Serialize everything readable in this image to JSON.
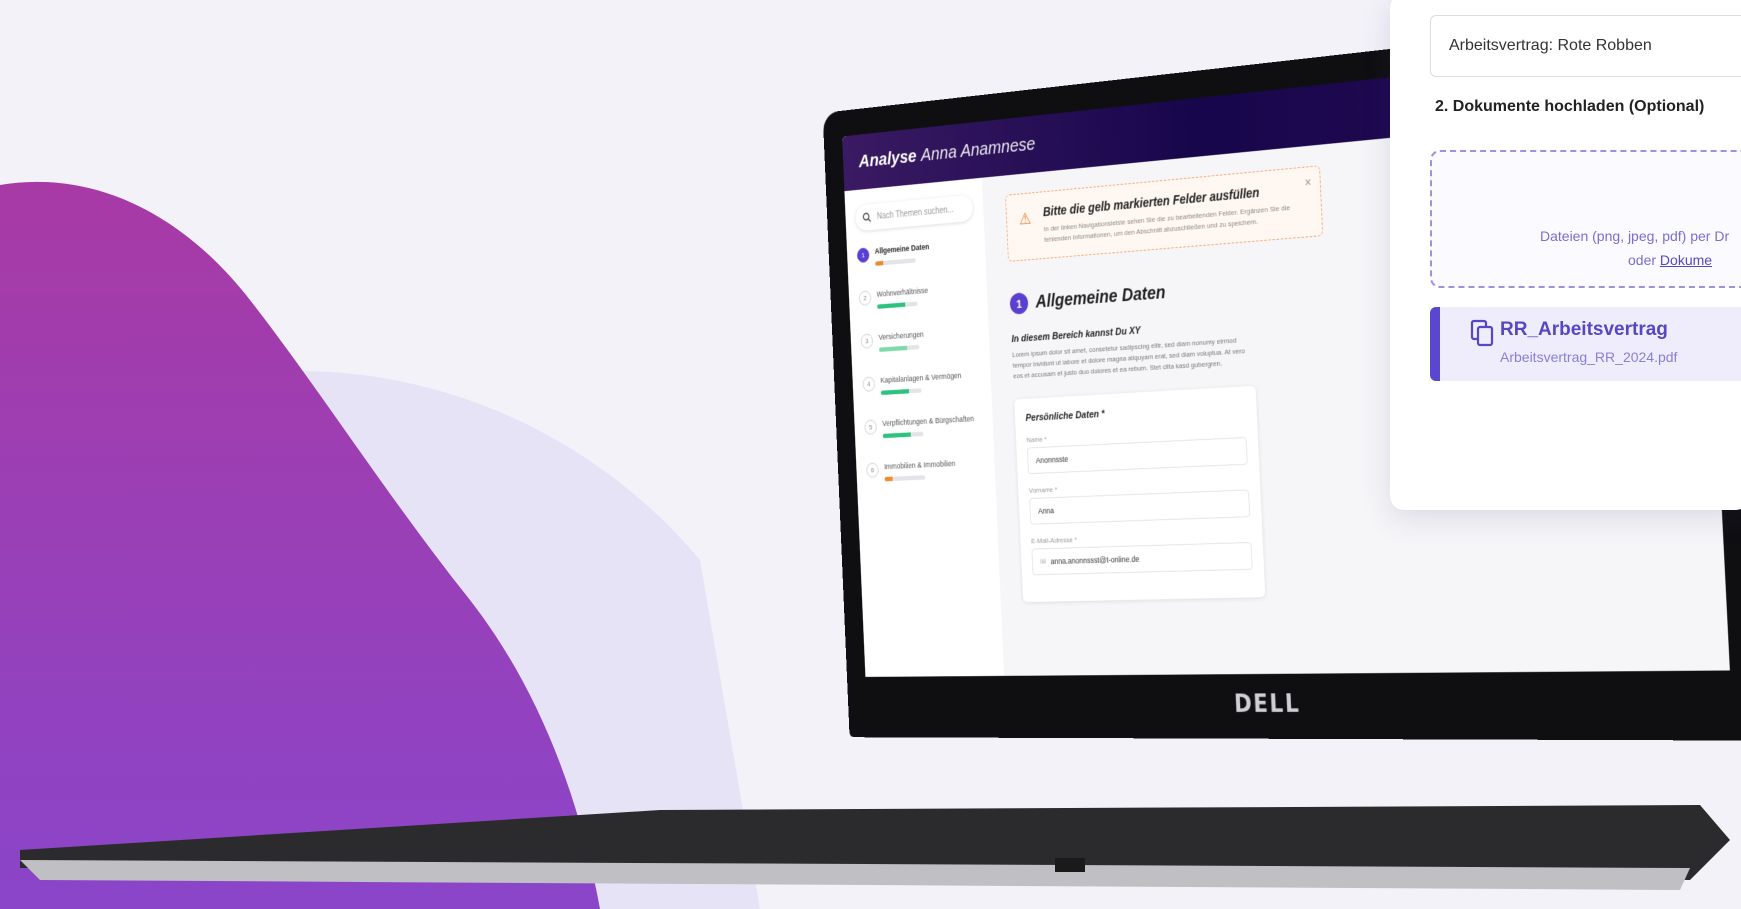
{
  "app": {
    "title_bold": "Analyse",
    "title_light": "Anna Anamnese",
    "brand": "DELL"
  },
  "sidebar": {
    "search_placeholder": "Nach Themen suchen...",
    "steps": [
      {
        "num": "1",
        "label": "Allgemeine Daten",
        "progress": 0.2,
        "color": "#f08a2a"
      },
      {
        "num": "2",
        "label": "Wohnverhältnisse",
        "progress": 0.7,
        "color": "#2ec27e"
      },
      {
        "num": "3",
        "label": "Versicherungen",
        "progress": 0.7,
        "color": "#7ed9ab"
      },
      {
        "num": "4",
        "label": "Kapitalanlagen & Vermögen",
        "progress": 0.7,
        "color": "#2ec27e"
      },
      {
        "num": "5",
        "label": "Verpflichtungen & Bürgschaften",
        "progress": 0.7,
        "color": "#2ec27e"
      },
      {
        "num": "6",
        "label": "Immobilien & Immobilien",
        "progress": 0.2,
        "color": "#f08a2a"
      }
    ]
  },
  "alert": {
    "title": "Bitte die gelb markierten Felder ausfüllen",
    "text": "In der linken Navigationsleiste sehen Sie die zu bearbeitenden Felder. Ergänzen Sie die fehlenden Informationen, um den Abschnitt abzuschließen und zu speichern.",
    "close": "×"
  },
  "section": {
    "num": "1",
    "title": "Allgemeine Daten",
    "subtitle": "In diesem Bereich kannst Du XY",
    "text": "Lorem ipsum dolor sit amet, consetetur sadipscing elitr, sed diam nonumy eirmod tempor invidunt ut labore et dolore magna aliquyam erat, sed diam voluptua. At vero eos et accusam et justo duo dolores et ea rebum. Stet clita kasd gubergren."
  },
  "personal": {
    "title": "Persönliche Daten *",
    "fields": [
      {
        "label": "Name *",
        "value": "Anonnsste"
      },
      {
        "label": "Vorname *",
        "value": "Anna"
      },
      {
        "label": "E-Mail-Adresse *",
        "value": "anna.anonnssst@t-online.de"
      }
    ]
  },
  "panel": {
    "input_value": "Arbeitsvertrag: Rote Robben",
    "step_label": "2. Dokumente hochladen (Optional)",
    "dropzone_text": "Dateien (png, jpeg, pdf) per Dr",
    "dropzone_or": "oder ",
    "dropzone_link": "Dokume",
    "file": {
      "name": "RR_Arbeitsvertrag",
      "filename": "Arbeitsvertrag_RR_2024.pdf"
    }
  },
  "colors": {
    "accent": "#5b3fd1",
    "blob": "#9a3ebd",
    "header": "#17064b"
  }
}
